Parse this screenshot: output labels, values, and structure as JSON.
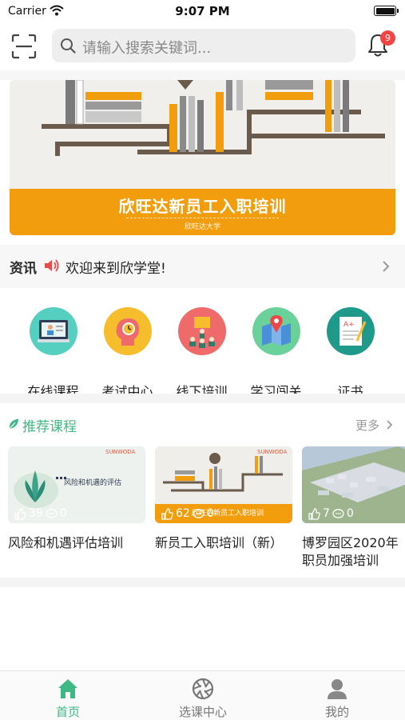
{
  "status_bar": {
    "carrier": "Carrier",
    "time": "9:07 PM"
  },
  "header": {
    "search_placeholder": "请输入搜索关键词...",
    "notification_count": "9"
  },
  "banner": {
    "title": "欣旺达新员工入职培训",
    "subtitle": "欣旺达大学"
  },
  "news": {
    "label": "资讯",
    "text": "欢迎来到欣学堂!"
  },
  "quick_menu": [
    {
      "label": "在线课程",
      "icon": "online-course-icon",
      "color": "#55d0c0"
    },
    {
      "label": "考试中心",
      "icon": "exam-center-icon",
      "color": "#f6bd2c"
    },
    {
      "label": "线下培训",
      "icon": "offline-training-icon",
      "color": "#ef6b6b"
    },
    {
      "label": "学习闯关",
      "icon": "learning-map-icon",
      "color": "#6bd19a"
    },
    {
      "label": "证书",
      "icon": "certificate-icon",
      "color": "#1f9a8a"
    }
  ],
  "recommend": {
    "title": "推荐课程",
    "more": "更多",
    "courses": [
      {
        "name": "风险和机遇评估培训",
        "likes": "39",
        "comments": "0",
        "thumb_text": "风险和机遇的评估",
        "brand": "SUNWODA"
      },
      {
        "name": "新员工入职培训（新）",
        "likes": "62",
        "comments": "0",
        "thumb_text": "欣旺达新员工入职培训",
        "brand": "SUNWODA"
      },
      {
        "name": "博罗园区2020年职员加强培训",
        "likes": "7",
        "comments": "0",
        "thumb_text": "",
        "brand": ""
      }
    ]
  },
  "tabs": [
    {
      "label": "首页",
      "icon": "home-icon",
      "active": true
    },
    {
      "label": "选课中心",
      "icon": "aperture-icon",
      "active": false
    },
    {
      "label": "我的",
      "icon": "user-icon",
      "active": false
    }
  ],
  "colors": {
    "accent": "#3fb984",
    "banner_orange": "#f29d0e",
    "badge": "#ef4545"
  }
}
